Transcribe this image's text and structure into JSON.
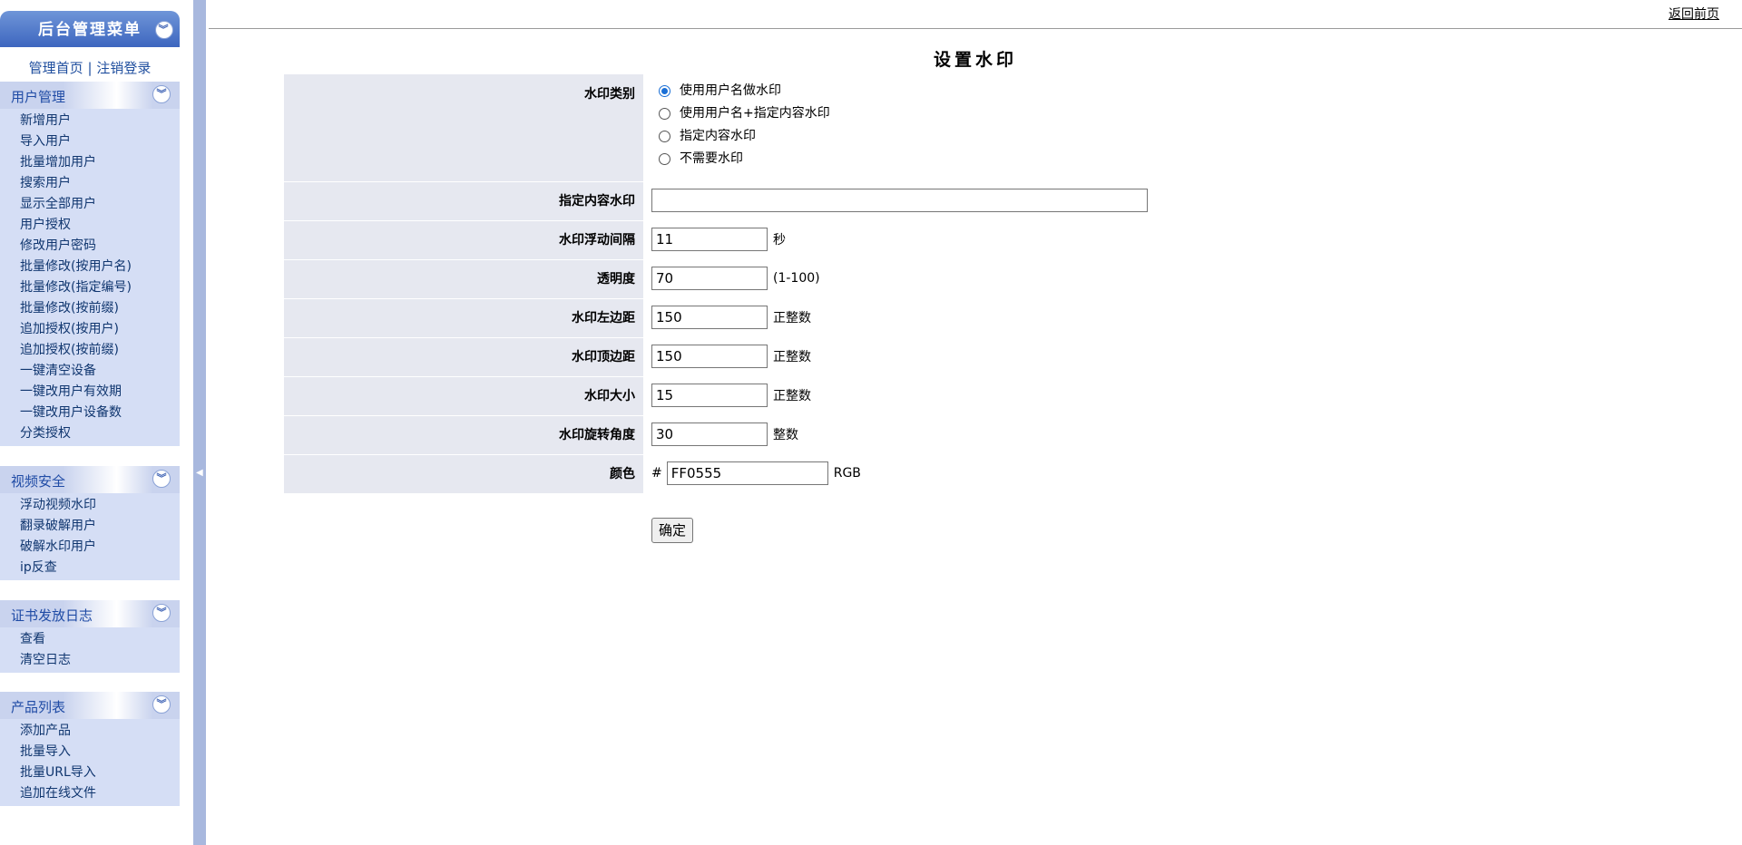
{
  "sidebar": {
    "menu_title": "后台管理菜单",
    "top_links": {
      "home": "管理首页",
      "separator": "|",
      "logout": "注销登录"
    },
    "collapse_glyph": "︾",
    "groups": [
      {
        "title": "用户管理",
        "items": [
          "新增用户",
          "导入用户",
          "批量增加用户",
          "搜索用户",
          "显示全部用户",
          "用户授权",
          "修改用户密码",
          "批量修改(按用户名)",
          "批量修改(指定编号)",
          "批量修改(按前缀)",
          "追加授权(按用户)",
          "追加授权(按前缀)",
          "一键清空设备",
          "一键改用户有效期",
          "一键改用户设备数",
          "分类授权"
        ]
      },
      {
        "title": "视频安全",
        "items": [
          "浮动视频水印",
          "翻录破解用户",
          "破解水印用户",
          "ip反查"
        ]
      },
      {
        "title": "证书发放日志",
        "items": [
          "查看",
          "清空日志"
        ]
      },
      {
        "title": "产品列表",
        "items": [
          "添加产品",
          "批量导入",
          "批量URL导入",
          "追加在线文件"
        ]
      }
    ]
  },
  "header": {
    "back_link": "返回前页",
    "page_title": "设置水印"
  },
  "form": {
    "watermark_type": {
      "label": "水印类别",
      "options": [
        "使用用户名做水印",
        "使用用户名+指定内容水印",
        "指定内容水印",
        "不需要水印"
      ],
      "selected_index": 0
    },
    "custom_text": {
      "label": "指定内容水印",
      "value": ""
    },
    "float_interval": {
      "label": "水印浮动间隔",
      "value": "11",
      "suffix": "秒"
    },
    "opacity": {
      "label": "透明度",
      "value": "70",
      "suffix": "(1-100)"
    },
    "left_margin": {
      "label": "水印左边距",
      "value": "150",
      "suffix": "正整数"
    },
    "top_margin": {
      "label": "水印顶边距",
      "value": "150",
      "suffix": "正整数"
    },
    "size": {
      "label": "水印大小",
      "value": "15",
      "suffix": "正整数"
    },
    "rotation": {
      "label": "水印旋转角度",
      "value": "30",
      "suffix": "整数"
    },
    "color": {
      "label": "颜色",
      "prefix": "#",
      "value": "FF0555",
      "suffix": "RGB"
    },
    "submit_label": "确定"
  },
  "colors": {
    "menu_header": "#3d66bf",
    "group_bg": "#d5def5",
    "label_bg": "#e6e8f0",
    "splitter": "#a8b8de"
  }
}
